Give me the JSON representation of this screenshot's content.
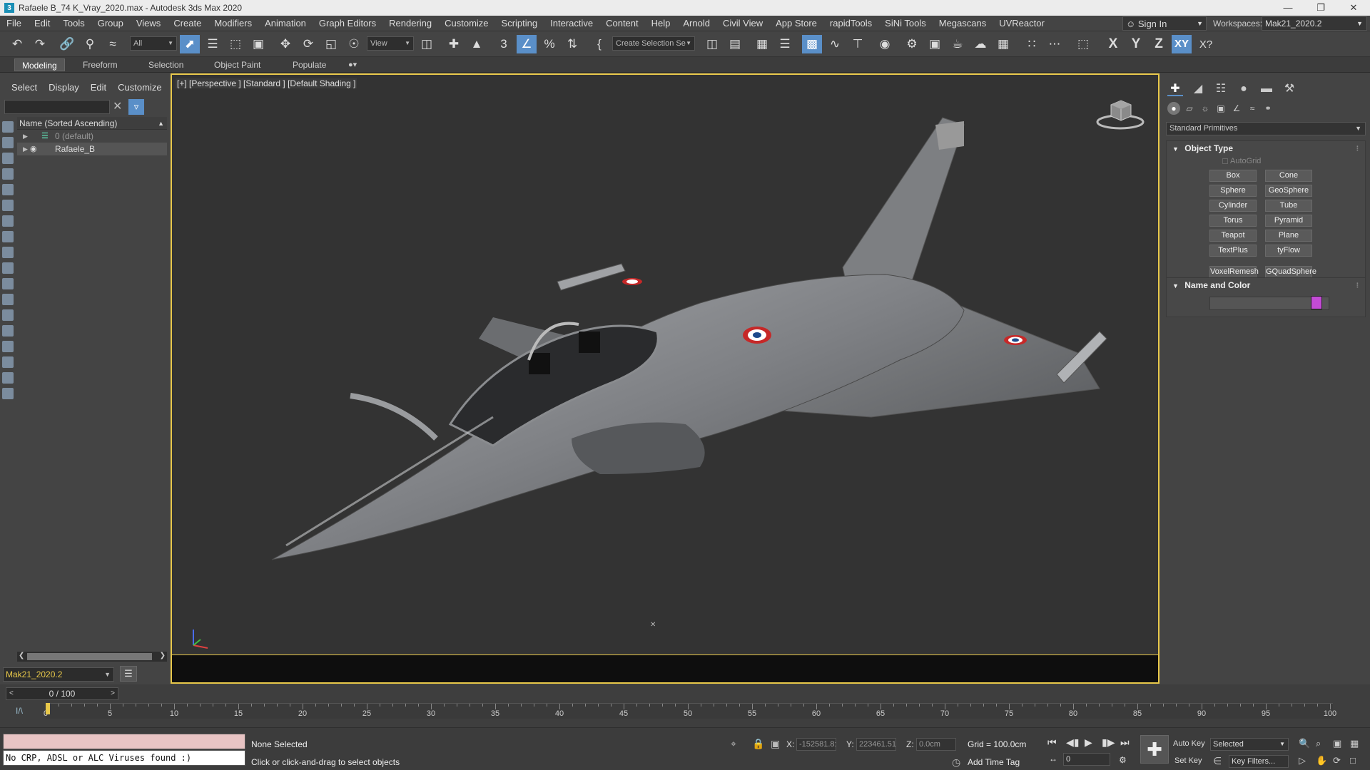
{
  "window": {
    "title": "Rafaele B_74 K_Vray_2020.max - Autodesk 3ds Max 2020",
    "app_icon": "3"
  },
  "menu": {
    "items": [
      "File",
      "Edit",
      "Tools",
      "Group",
      "Views",
      "Create",
      "Modifiers",
      "Animation",
      "Graph Editors",
      "Rendering",
      "Customize",
      "Scripting",
      "Interactive",
      "Content",
      "Help",
      "Arnold",
      "Civil View",
      "App Store",
      "rapidTools",
      "SiNi Tools",
      "Megascans",
      "UVReactor"
    ],
    "sign_in": "Sign In",
    "workspaces_label": "Workspaces:",
    "workspace_value": "Mak21_2020.2"
  },
  "toolbar": {
    "selection_filter": "All",
    "ref_coord": "View",
    "named_selection_placeholder": "Create Selection Se",
    "axes": [
      "X",
      "Y",
      "Z",
      "XY"
    ]
  },
  "ribbon": {
    "tabs": [
      "Modeling",
      "Freeform",
      "Selection",
      "Object Paint",
      "Populate"
    ],
    "active_tab": "Modeling"
  },
  "scene_explorer": {
    "tabs": [
      "Select",
      "Display",
      "Edit",
      "Customize"
    ],
    "column_header": "Name (Sorted Ascending)",
    "rows": [
      {
        "label": "0 (default)"
      },
      {
        "label": "Rafaele_B"
      }
    ],
    "layer_field": "Mak21_2020.2"
  },
  "viewport": {
    "label": "[+] [Perspective ] [Standard ] [Default Shading ]"
  },
  "command_panel": {
    "category": "Standard Primitives",
    "object_type_title": "Object Type",
    "autogrid_label": "AutoGrid",
    "primitives": [
      "Box",
      "Cone",
      "Sphere",
      "GeoSphere",
      "Cylinder",
      "Tube",
      "Torus",
      "Pyramid",
      "Teapot",
      "Plane",
      "TextPlus",
      "tyFlow",
      "VoxelRemesh",
      "GQuadSphere"
    ],
    "name_color_title": "Name and Color",
    "object_color": "#c44bd6"
  },
  "timeline": {
    "frame_display": "0 / 100",
    "tick_labels": [
      "0",
      "5",
      "10",
      "15",
      "20",
      "25",
      "30",
      "35",
      "40",
      "45",
      "50",
      "55",
      "60",
      "65",
      "70",
      "75",
      "80",
      "85",
      "90",
      "95",
      "100"
    ],
    "curve_icon_label": "I/\\"
  },
  "status": {
    "maxscript_output": "No CRP, ADSL or ALC Viruses found :)",
    "selection": "None Selected",
    "prompt": "Click or click-and-drag to select objects",
    "x_label": "X:",
    "x_value": "-152581.8:",
    "y_label": "Y:",
    "y_value": "223461.51",
    "z_label": "Z:",
    "z_value": "0.0cm",
    "grid": "Grid = 100.0cm",
    "add_time_tag": "Add Time Tag",
    "frame_field": "0",
    "auto_key": "Auto Key",
    "set_key": "Set Key",
    "key_mode": "Selected",
    "key_filters": "Key Filters..."
  },
  "colors": {
    "accent": "#5a8fc8",
    "viewport_border": "#e8c84a"
  }
}
